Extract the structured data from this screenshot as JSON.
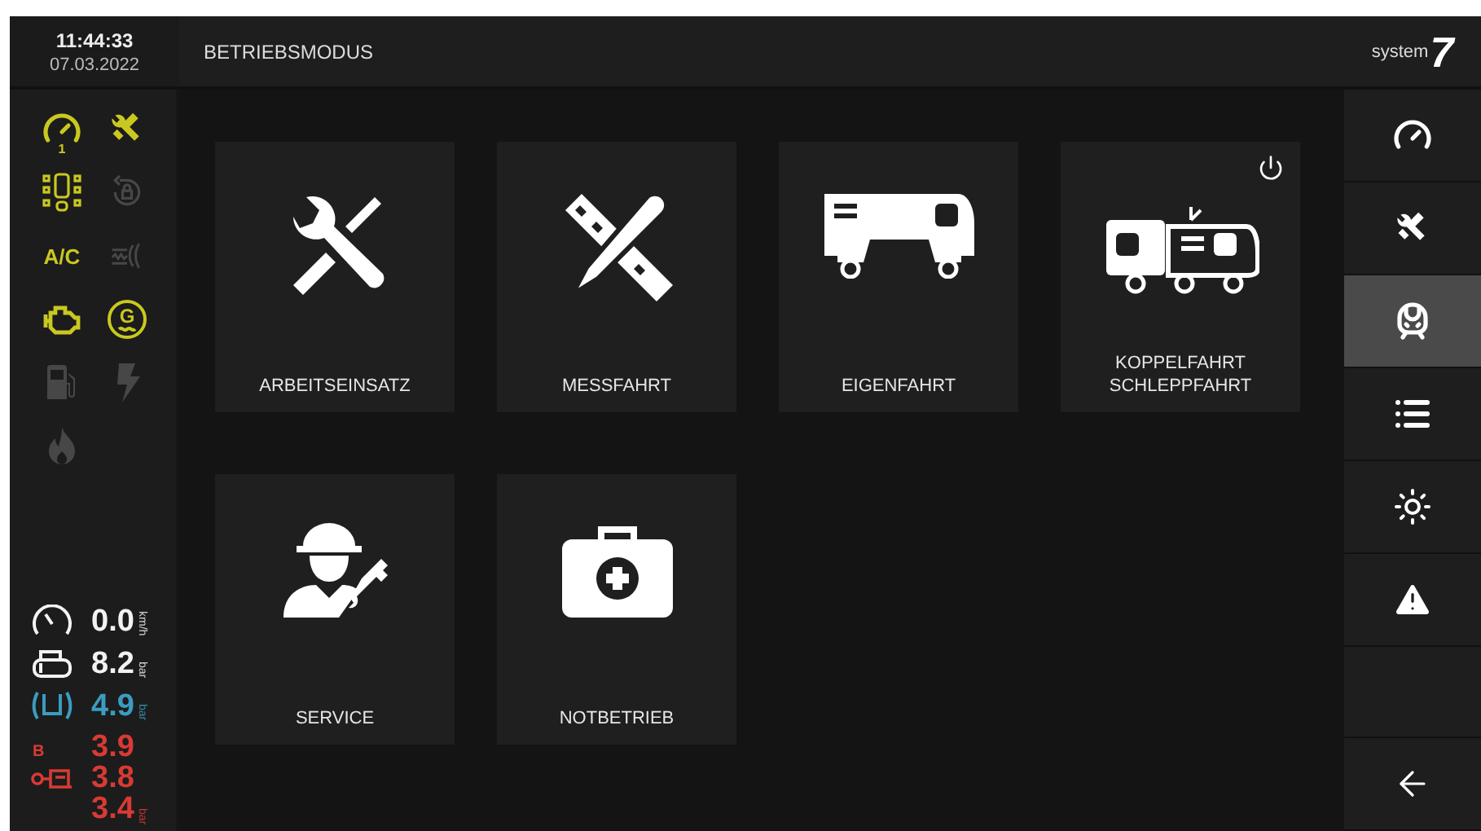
{
  "header": {
    "time": "11:44:33",
    "date": "07.03.2022",
    "title": "BETRIEBSMODUS",
    "logo": {
      "text": "system",
      "mark": "7"
    }
  },
  "indicators": [
    {
      "kind": "gauge",
      "label": "1",
      "active": true
    },
    {
      "kind": "wrench-satellite",
      "active": true
    },
    {
      "kind": "seats",
      "active": true
    },
    {
      "kind": "rotate-lock",
      "active": false
    },
    {
      "kind": "text",
      "label": "A/C",
      "active": true
    },
    {
      "kind": "heater",
      "active": false
    },
    {
      "kind": "engine",
      "active": true
    },
    {
      "kind": "generator",
      "label": "G",
      "active": true
    },
    {
      "kind": "fuel",
      "active": false
    },
    {
      "kind": "bolt",
      "active": false
    },
    {
      "kind": "flame",
      "active": false
    }
  ],
  "readings": [
    {
      "kind": "speed",
      "values": [
        "0.0"
      ],
      "unit": "km/h",
      "color": "#f2f2f2"
    },
    {
      "kind": "tank",
      "values": [
        "8.2"
      ],
      "unit": "bar",
      "color": "#f2f2f2"
    },
    {
      "kind": "pipe",
      "values": [
        "4.9"
      ],
      "unit": "bar",
      "color": "#3b9cc0"
    },
    {
      "kind": "brake",
      "label": "B",
      "values": [
        "3.9",
        "3.8",
        "3.4"
      ],
      "unit": "bar",
      "color": "#d83a34"
    }
  ],
  "tiles": [
    {
      "kind": "tools",
      "label": "ARBEITSEINSATZ",
      "power": false
    },
    {
      "kind": "measure",
      "label": "MESSFAHRT",
      "power": false
    },
    {
      "kind": "vehicle",
      "label": "EIGENFAHRT",
      "power": false
    },
    {
      "kind": "coupled",
      "label": "KOPPELFAHRT\nSCHLEPPFAHRT",
      "power": true
    },
    {
      "kind": "service",
      "label": "SERVICE",
      "power": false
    },
    {
      "kind": "aid",
      "label": "NOTBETRIEB",
      "power": false
    }
  ],
  "nav": [
    {
      "kind": "gauge",
      "selected": false
    },
    {
      "kind": "wrench-satellite",
      "selected": false
    },
    {
      "kind": "train",
      "selected": true
    },
    {
      "kind": "list",
      "selected": false
    },
    {
      "kind": "sun",
      "selected": false
    },
    {
      "kind": "warning",
      "selected": false
    },
    {
      "kind": "empty",
      "selected": false
    },
    {
      "kind": "back",
      "selected": false
    }
  ]
}
